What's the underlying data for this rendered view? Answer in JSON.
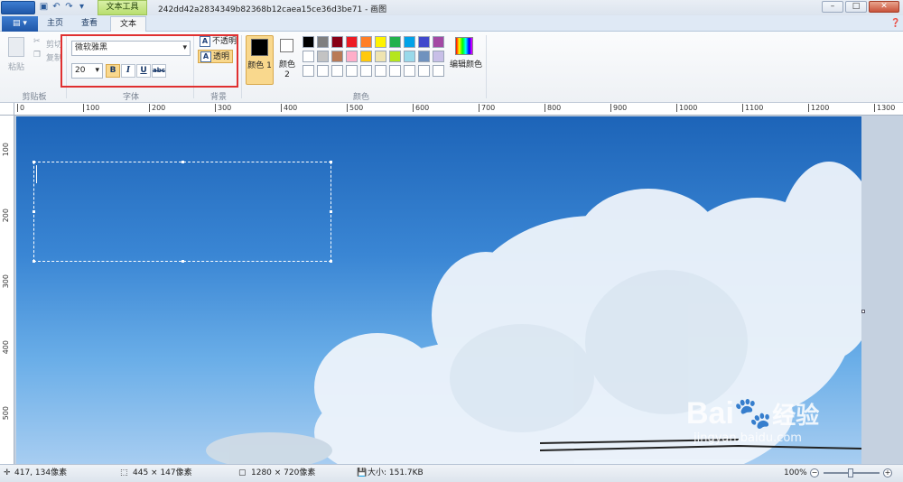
{
  "titlebar": {
    "context_tab": "文本工具",
    "document_title": "242dd42a2834349b82368b12caea15ce36d3be71 - 画图",
    "minimize": "–",
    "maximize": "□",
    "close": "✕"
  },
  "tabs": [
    {
      "label": "主页"
    },
    {
      "label": "查看"
    },
    {
      "label": "文本"
    }
  ],
  "clipboard": {
    "paste": "粘贴",
    "cut": "剪切",
    "copy": "复制",
    "group": "剪贴板"
  },
  "font": {
    "family": "微软雅黑",
    "size": "20",
    "bold": "B",
    "italic": "I",
    "underline": "U",
    "strike": "abc",
    "group": "字体"
  },
  "background": {
    "opaque": "不透明",
    "transparent": "透明",
    "group": "背景"
  },
  "colors": {
    "color1": "颜色 1",
    "color2": "颜色 2",
    "edit": "编辑颜色",
    "group": "颜色",
    "palette_row1": [
      "#000000",
      "#7f7f7f",
      "#880015",
      "#ed1c24",
      "#ff7f27",
      "#fff200",
      "#22b14c",
      "#00a2e8",
      "#3f48cc",
      "#a349a4"
    ],
    "palette_row2": [
      "#ffffff",
      "#c3c3c3",
      "#b97a57",
      "#ffaec9",
      "#ffc90e",
      "#efe4b0",
      "#b5e61d",
      "#99d9ea",
      "#7092be",
      "#c8bfe7"
    ]
  },
  "ruler": {
    "h": [
      "0",
      "100",
      "200",
      "300",
      "400",
      "500",
      "600",
      "700",
      "800",
      "900",
      "1000",
      "1100",
      "1200",
      "1300"
    ],
    "v": [
      "100",
      "200",
      "300",
      "400",
      "500"
    ]
  },
  "status": {
    "cursor": "417, 134像素",
    "selection": "445 × 147像素",
    "canvas_size": "1280 × 720像素",
    "file_size": "大小: 151.7KB",
    "zoom": "100%",
    "zoom_level": 1.0
  },
  "watermark": {
    "brand": "Bai",
    "brand2": "经验",
    "url": "jingyan.baidu.com"
  }
}
